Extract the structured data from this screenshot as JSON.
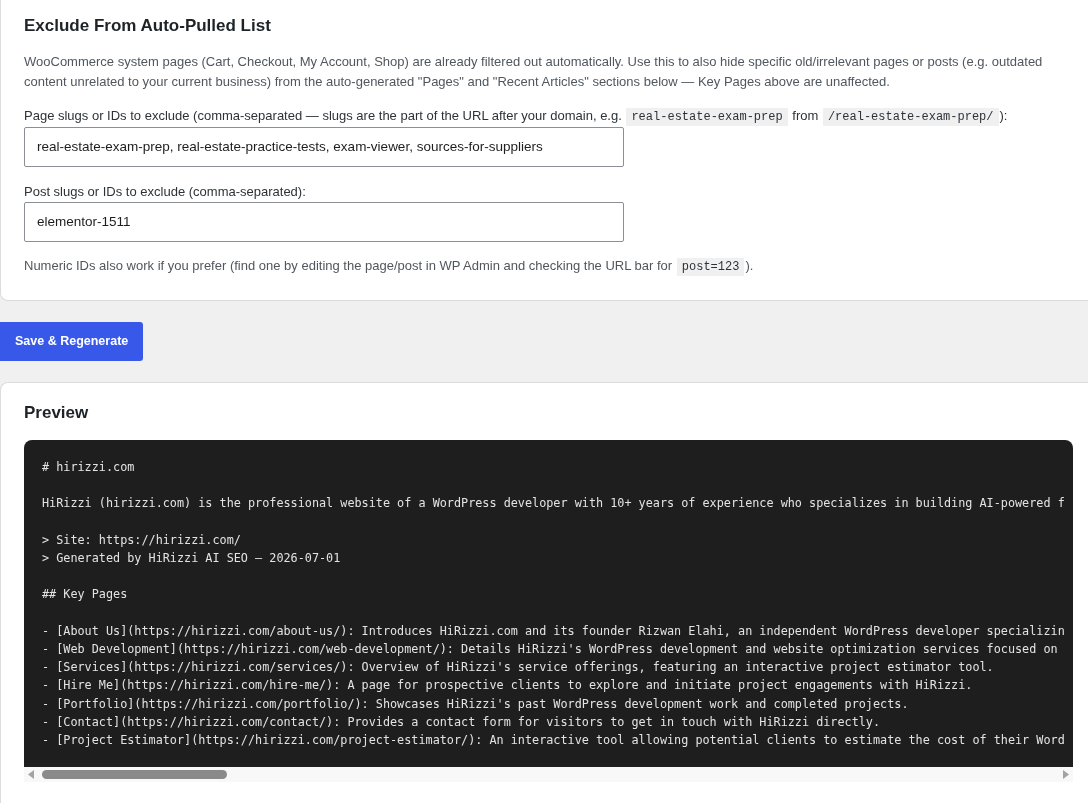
{
  "exclude_section": {
    "title": "Exclude From Auto-Pulled List",
    "description": "WooCommerce system pages (Cart, Checkout, My Account, Shop) are already filtered out automatically. Use this to also hide specific old/irrelevant pages or posts (e.g. outdated content unrelated to your current business) from the auto-generated \"Pages\" and \"Recent Articles\" sections below — Key Pages above are unaffected.",
    "fields": [
      {
        "label": [
          {
            "kind": "text",
            "text": "Page slugs or IDs to exclude (comma-separated — slugs are the part of the URL after your domain, e.g. "
          },
          {
            "kind": "code",
            "text": "real-estate-exam-prep"
          },
          {
            "kind": "text",
            "text": " from "
          },
          {
            "kind": "code",
            "text": "/real-estate-exam-prep/"
          },
          {
            "kind": "text",
            "text": "):"
          }
        ],
        "value": "real-estate-exam-prep, real-estate-practice-tests, exam-viewer, sources-for-suppliers"
      },
      {
        "label": [
          {
            "kind": "text",
            "text": "Post slugs or IDs to exclude (comma-separated):"
          }
        ],
        "value": "elementor-1511"
      }
    ],
    "note": [
      {
        "kind": "text",
        "text": "Numeric IDs also work if you prefer (find one by editing the page/post in WP Admin and checking the URL bar for "
      },
      {
        "kind": "code",
        "text": "post=123"
      },
      {
        "kind": "text",
        "text": ")."
      }
    ]
  },
  "save_button": {
    "label": "Save & Regenerate"
  },
  "preview": {
    "title": "Preview",
    "blocks": [
      [
        "# hirizzi.com"
      ],
      [
        "HiRizzi (hirizzi.com) is the professional website of a WordPress developer with 10+ years of experience who specializes in building AI-powered f"
      ],
      [
        "> Site: https://hirizzi.com/",
        "> Generated by HiRizzi AI SEO — 2026-07-01"
      ],
      [
        "## Key Pages"
      ],
      [
        "- [About Us](https://hirizzi.com/about-us/): Introduces HiRizzi.com and its founder Rizwan Elahi, an independent WordPress developer specializin",
        "- [Web Development](https://hirizzi.com/web-development/): Details HiRizzi's WordPress development and website optimization services focused on",
        "- [Services](https://hirizzi.com/services/): Overview of HiRizzi's service offerings, featuring an interactive project estimator tool.",
        "- [Hire Me](https://hirizzi.com/hire-me/): A page for prospective clients to explore and initiate project engagements with HiRizzi.",
        "- [Portfolio](https://hirizzi.com/portfolio/): Showcases HiRizzi's past WordPress development work and completed projects.",
        "- [Contact](https://hirizzi.com/contact/): Provides a contact form for visitors to get in touch with HiRizzi directly.",
        "- [Project Estimator](https://hirizzi.com/project-estimator/): An interactive tool allowing potential clients to estimate the cost of their Word"
      ]
    ]
  }
}
